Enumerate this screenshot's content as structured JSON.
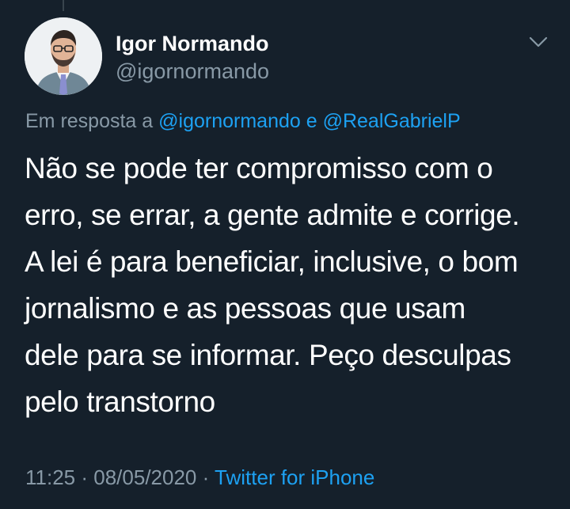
{
  "tweet": {
    "author": {
      "name": "Igor Normando",
      "handle": "@igornormando"
    },
    "reply_to": {
      "prefix": "Em resposta a ",
      "user1": "@igornormando",
      "connector": " e ",
      "user2": "@RealGabrielP"
    },
    "text": "Não se pode ter compromisso com o\nerro, se errar, a gente admite e corrige.\nA lei é para beneficiar, inclusive, o bom\njornalismo e as pessoas que usam\ndele para se informar. Peço desculpas\npelo transtorno",
    "time": "11:25",
    "separator": " · ",
    "date": "08/05/2020",
    "source": "Twitter for iPhone"
  },
  "icons": {
    "menu": "chevron-down-icon"
  },
  "colors": {
    "background": "#15202b",
    "text_primary": "#ffffff",
    "text_secondary": "#8899a6",
    "link": "#1da1f2"
  }
}
